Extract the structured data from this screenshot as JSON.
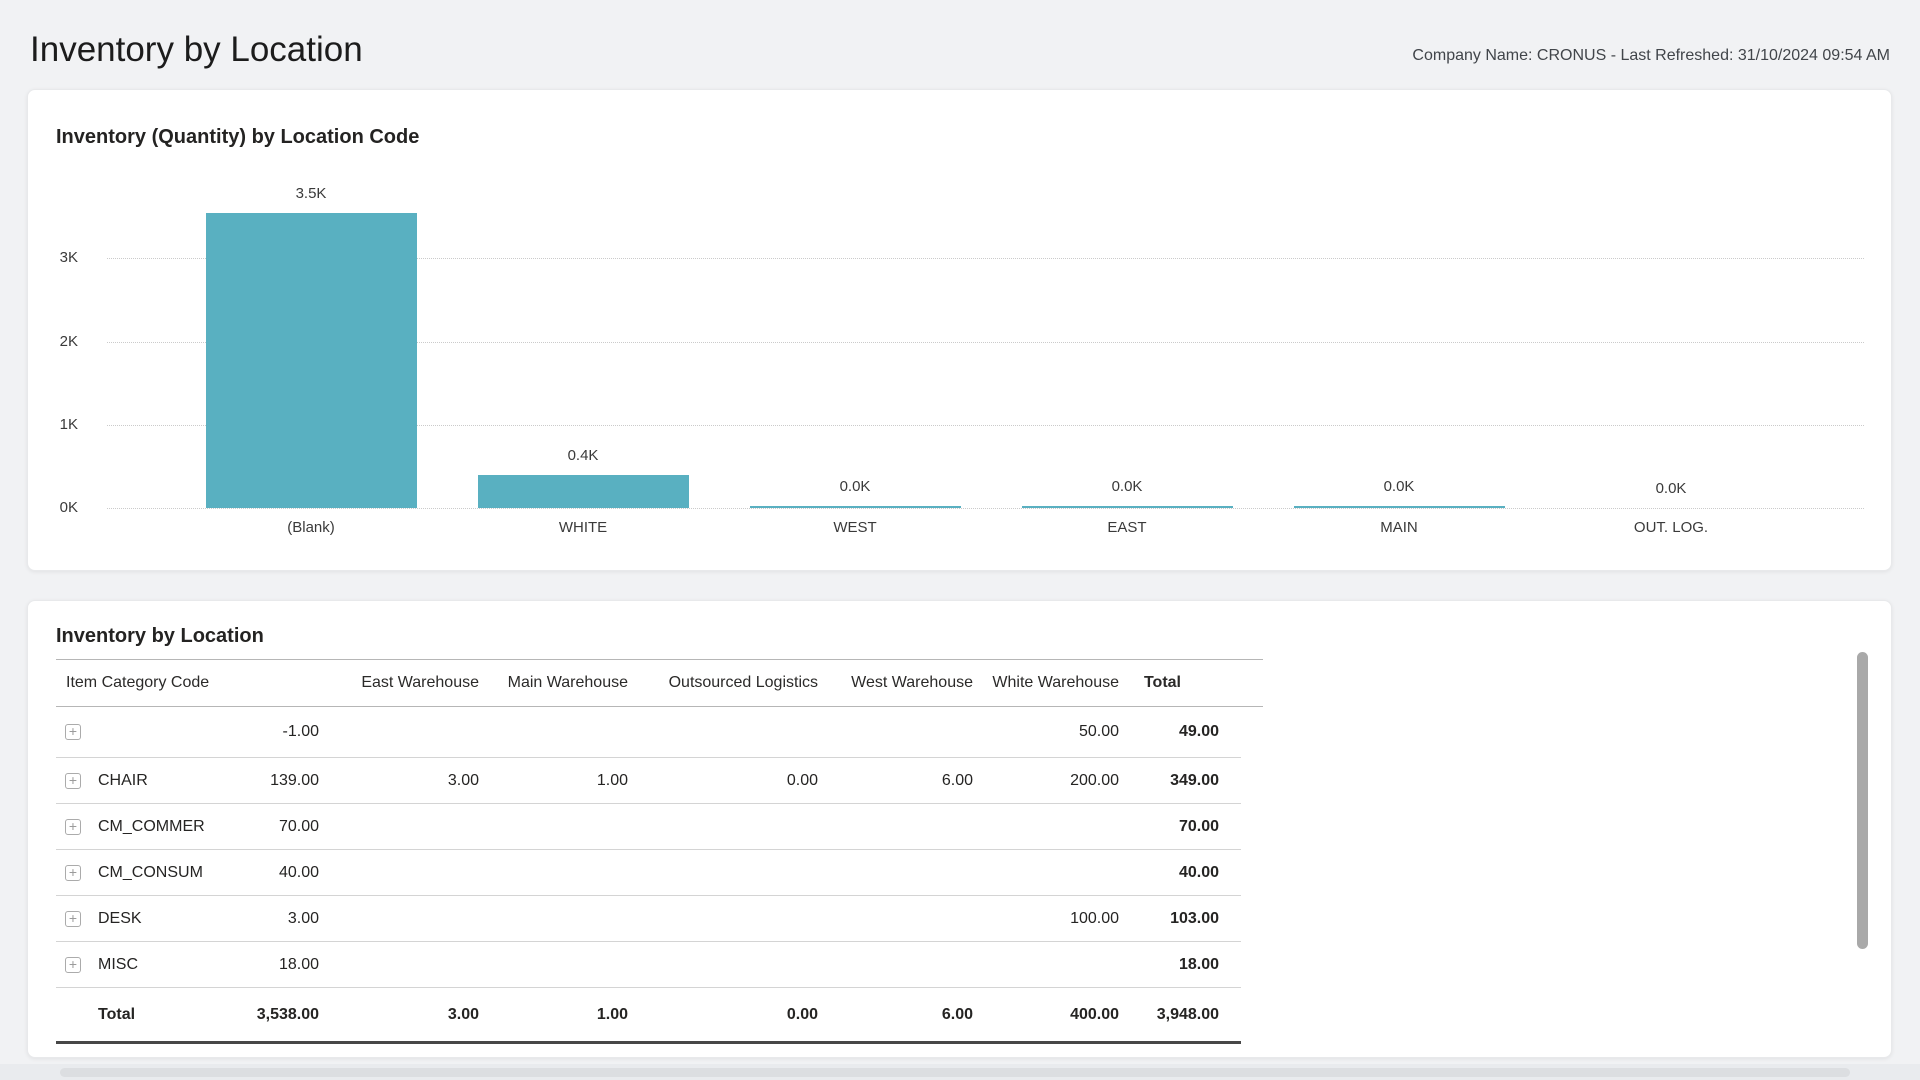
{
  "page": {
    "title": "Inventory by Location",
    "meta": "Company Name: CRONUS - Last Refreshed: 31/10/2024 09:54 AM",
    "background_color": "#f1f2f4"
  },
  "chart_data": {
    "type": "bar",
    "title": "Inventory (Quantity) by Location Code",
    "categories": [
      "(Blank)",
      "WHITE",
      "WEST",
      "EAST",
      "MAIN",
      "OUT. LOG."
    ],
    "values": [
      3538,
      400,
      6,
      3,
      1,
      0
    ],
    "value_labels": [
      "3.5K",
      "0.4K",
      "0.0K",
      "0.0K",
      "0.0K",
      "0.0K"
    ],
    "y_ticks": [
      {
        "label": "0K",
        "value": 0
      },
      {
        "label": "1K",
        "value": 1000
      },
      {
        "label": "2K",
        "value": 2000
      },
      {
        "label": "3K",
        "value": 3000
      }
    ],
    "ylim": [
      0,
      3600
    ],
    "xlabel": "",
    "ylabel": "",
    "grid": "horizontal-dotted",
    "legend": "none",
    "bar_color": "#59b0c1"
  },
  "table": {
    "title": "Inventory by Location",
    "expander_glyph": "+",
    "columns": [
      "Item Category Code",
      "",
      "East Warehouse",
      "Main Warehouse",
      "Outsourced Logistics",
      "West Warehouse",
      "White Warehouse",
      "Total"
    ],
    "rows": [
      {
        "category": "",
        "values": [
          "-1.00",
          "",
          "",
          "",
          "",
          "50.00"
        ],
        "total": "49.00"
      },
      {
        "category": "CHAIR",
        "values": [
          "139.00",
          "3.00",
          "1.00",
          "0.00",
          "6.00",
          "200.00"
        ],
        "total": "349.00"
      },
      {
        "category": "CM_COMMER",
        "values": [
          "70.00",
          "",
          "",
          "",
          "",
          ""
        ],
        "total": "70.00"
      },
      {
        "category": "CM_CONSUM",
        "values": [
          "40.00",
          "",
          "",
          "",
          "",
          ""
        ],
        "total": "40.00"
      },
      {
        "category": "DESK",
        "values": [
          "3.00",
          "",
          "",
          "",
          "",
          "100.00"
        ],
        "total": "103.00"
      },
      {
        "category": "MISC",
        "values": [
          "18.00",
          "",
          "",
          "",
          "",
          ""
        ],
        "total": "18.00"
      }
    ],
    "total_row": {
      "label": "Total",
      "values": [
        "3,538.00",
        "3.00",
        "1.00",
        "0.00",
        "6.00",
        "400.00"
      ],
      "total": "3,948.00"
    }
  }
}
